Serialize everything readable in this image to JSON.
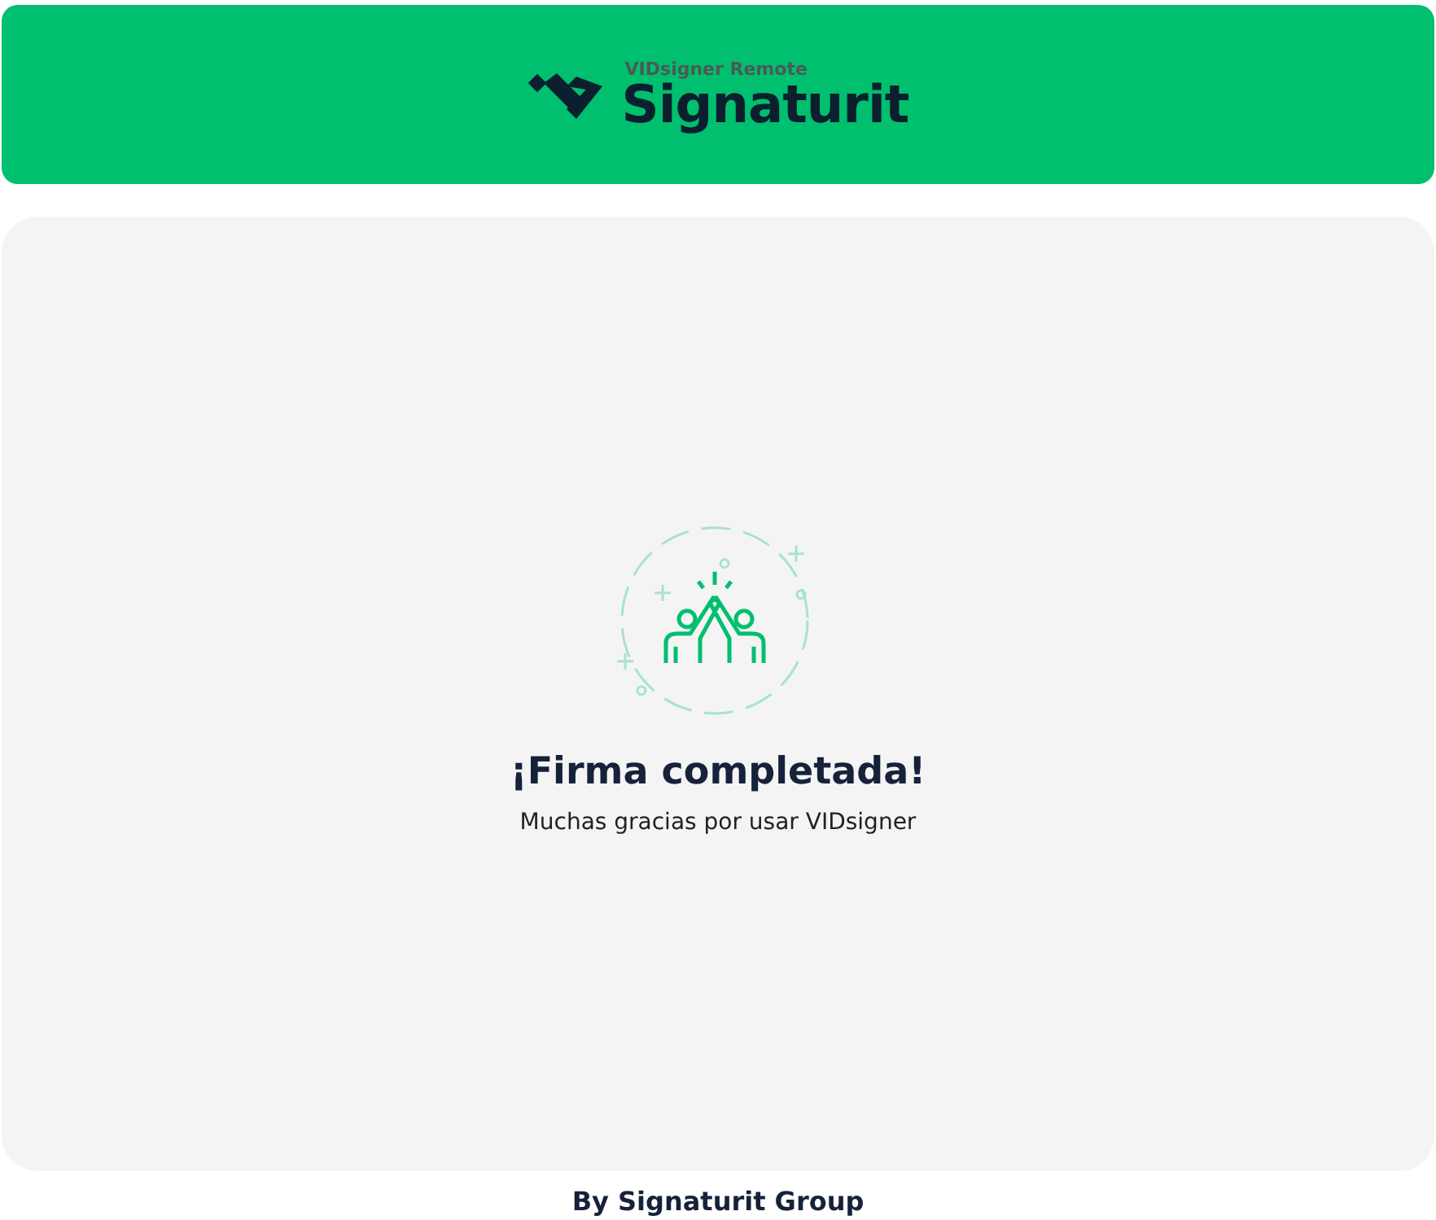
{
  "header": {
    "subtitle": "VIDsigner Remote",
    "brand": "Signaturit"
  },
  "message": {
    "title": "¡Firma completada!",
    "text": "Muchas gracias por usar VIDsigner"
  },
  "footer": "By Signaturit Group"
}
